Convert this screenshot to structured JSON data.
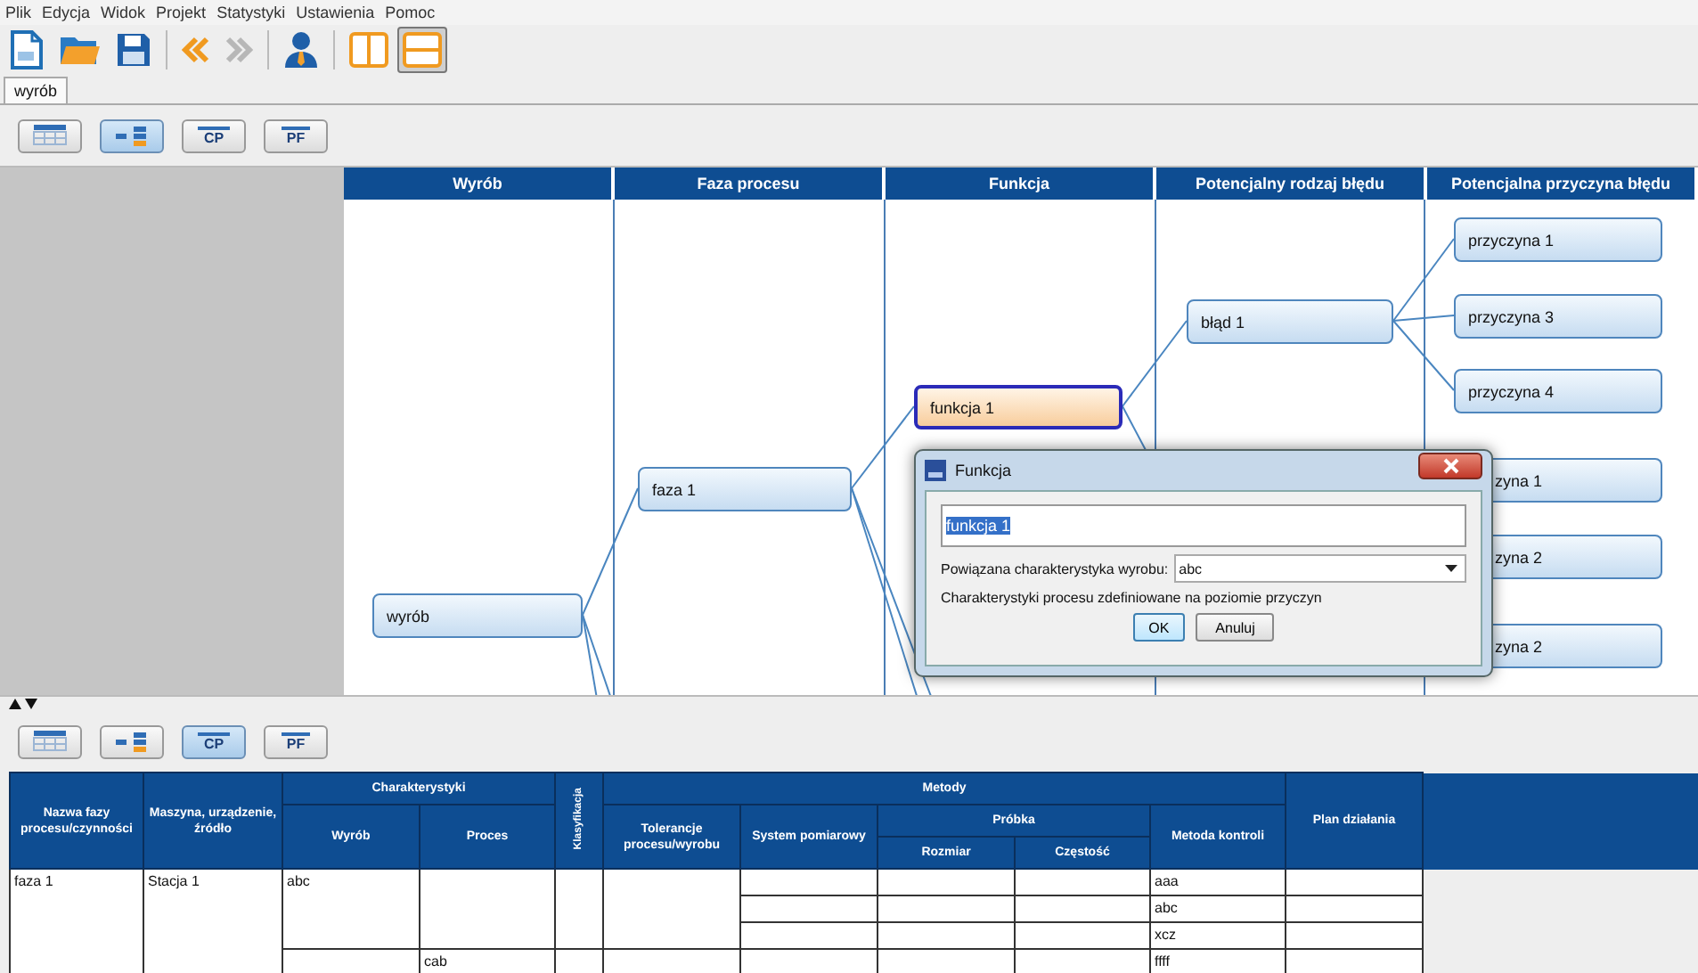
{
  "menu": [
    "Plik",
    "Edycja",
    "Widok",
    "Projekt",
    "Statystyki",
    "Ustawienia",
    "Pomoc"
  ],
  "toolbar": [
    {
      "kind": "new",
      "disabled": false,
      "pressed": false
    },
    {
      "kind": "open",
      "disabled": false,
      "pressed": false
    },
    {
      "kind": "save",
      "disabled": false,
      "pressed": false
    },
    {
      "kind": "separator"
    },
    {
      "kind": "back",
      "disabled": false,
      "pressed": false
    },
    {
      "kind": "forward",
      "disabled": true,
      "pressed": false
    },
    {
      "kind": "separator"
    },
    {
      "kind": "person",
      "disabled": false,
      "pressed": false
    },
    {
      "kind": "separator"
    },
    {
      "kind": "columns-view",
      "disabled": false,
      "pressed": false
    },
    {
      "kind": "rows-view",
      "disabled": false,
      "pressed": true
    }
  ],
  "tabs": [
    {
      "label": "wyrób",
      "selected": true
    }
  ],
  "mode_bar_top": [
    {
      "kind": "table",
      "selected": false
    },
    {
      "kind": "tree",
      "selected": true
    },
    {
      "kind": "text",
      "label": "CP",
      "selected": false
    },
    {
      "kind": "text",
      "label": "PF",
      "selected": false
    }
  ],
  "diagram": {
    "columns": [
      {
        "title": "Wyrób",
        "nodes": [
          {
            "label": "wyrób",
            "selected": false,
            "covered": false
          }
        ]
      },
      {
        "title": "Faza procesu",
        "nodes": [
          {
            "label": "faza 1",
            "selected": false,
            "covered": false
          }
        ]
      },
      {
        "title": "Funkcja",
        "nodes": [
          {
            "label": "funkcja 1",
            "selected": true,
            "covered": false
          }
        ]
      },
      {
        "title": "Potencjalny rodzaj błędu",
        "nodes": [
          {
            "label": "błąd 1",
            "selected": false,
            "covered": false
          }
        ]
      },
      {
        "title": "Potencjalna przyczyna błędu",
        "nodes": [
          {
            "label": "przyczyna 1",
            "selected": false,
            "covered": false
          },
          {
            "label": "przyczyna 3",
            "selected": false,
            "covered": false
          },
          {
            "label": "przyczyna 4",
            "selected": false,
            "covered": false
          },
          {
            "label": "zyna 1",
            "selected": false,
            "covered": true
          },
          {
            "label": "zyna 2",
            "selected": false,
            "covered": true
          },
          {
            "label": "zyna 2",
            "selected": false,
            "covered": true
          }
        ]
      }
    ]
  },
  "dialog": {
    "title": "Funkcja",
    "field": {
      "value": "funkcja 1",
      "text_selected": true
    },
    "combo_label": "Powiązana charakterystyka wyrobu:",
    "combo_value": "abc",
    "note": "Charakterystyki procesu zdefiniowane na poziomie przyczyn",
    "buttons": [
      "OK",
      "Anuluj"
    ]
  },
  "mode_bar_bottom": [
    {
      "kind": "table",
      "selected": false
    },
    {
      "kind": "tree",
      "selected": false
    },
    {
      "kind": "text",
      "label": "CP",
      "selected": true
    },
    {
      "kind": "text",
      "label": "PF",
      "selected": false
    }
  ],
  "table": {
    "columns": [
      {
        "label": "Nazwa fazy procesu/czynności"
      },
      {
        "label": "Maszyna, urządzenie, źródło"
      },
      {
        "label": "Charakterystyki",
        "colspan": 2,
        "children": [
          {
            "label": "Wyrób"
          },
          {
            "label": "Proces"
          }
        ]
      },
      {
        "label": "Klasyfikacja",
        "kind": "vertical"
      },
      {
        "label": "Metody",
        "colspan": 5,
        "children": [
          {
            "label": "Tolerancje procesu/wyrobu"
          },
          {
            "label": "System pomiarowy"
          },
          {
            "label": "Próbka",
            "colspan": 2,
            "children": [
              {
                "label": "Rozmiar"
              },
              {
                "label": "Częstość"
              }
            ]
          },
          {
            "label": "Metoda kontroli"
          }
        ]
      },
      {
        "label": "Plan działania"
      }
    ],
    "rows": [
      [
        {
          "text": "faza 1",
          "rowspan": 4
        },
        {
          "text": "Stacja 1",
          "rowspan": 4
        },
        {
          "text": "abc",
          "rowspan": 3
        },
        {
          "rowspan": 3
        },
        {
          "rowspan": 3
        },
        {
          "rowspan": 3
        },
        {},
        {},
        {},
        {
          "text": "aaa"
        },
        {}
      ],
      [
        {},
        {},
        {},
        {
          "text": "abc"
        },
        {}
      ],
      [
        {},
        {},
        {},
        {
          "text": "xcz"
        },
        {}
      ],
      [
        {},
        {
          "text": "cab"
        },
        {},
        {},
        {},
        {},
        {},
        {
          "text": "ffff"
        },
        {}
      ]
    ]
  }
}
